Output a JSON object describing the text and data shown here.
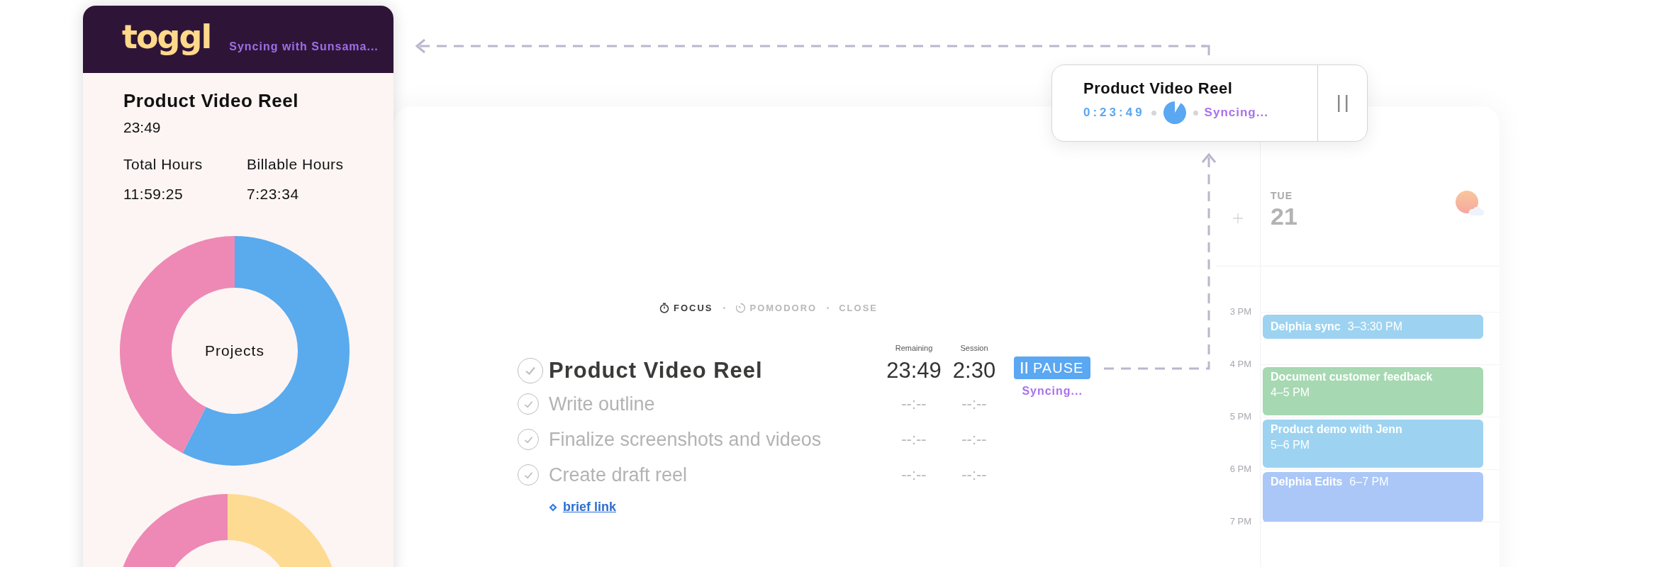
{
  "panel": {
    "logo": "toggl",
    "status": "Syncing with Sunsama...",
    "title": "Product Video Reel",
    "elapsed": "23:49",
    "stats": [
      {
        "label": "Total Hours",
        "value": "11:59:25"
      },
      {
        "label": "Billable Hours",
        "value": "7:23:34"
      }
    ],
    "donut_label": "Projects"
  },
  "mini_timer": {
    "title": "Product Video Reel",
    "elapsed": "0:23:49",
    "status": "Syncing..."
  },
  "focus": {
    "modes": [
      {
        "label": "FOCUS",
        "selected": true,
        "kind": "stopwatch"
      },
      {
        "label": "POMODORO",
        "selected": false,
        "kind": "timer"
      }
    ],
    "close": "CLOSE",
    "columns": [
      "Remaining",
      "Session"
    ],
    "tasks": [
      {
        "title": "Product Video Reel",
        "remaining": "23:49",
        "session": "2:30",
        "kind": "main",
        "checked": false
      },
      {
        "title": "Write outline",
        "remaining": "--:--",
        "session": "--:--",
        "kind": "subtask",
        "checked": false
      },
      {
        "title": "Finalize screenshots and videos",
        "remaining": "--:--",
        "session": "--:--",
        "kind": "subtask",
        "checked": false
      },
      {
        "title": "Create draft reel",
        "remaining": "--:--",
        "session": "--:--",
        "kind": "subtask",
        "checked": false
      }
    ],
    "link": "brief link",
    "pause": "PAUSE",
    "status": "Syncing..."
  },
  "calendar": {
    "weekday": "TUE",
    "day": "21",
    "hours": [
      {
        "label": "3 PM",
        "events": [
          {
            "title": "Delphia sync",
            "time": "3–3:30 PM",
            "kind": "short",
            "color": "#9dd3f0"
          }
        ]
      },
      {
        "label": "4 PM",
        "events": [
          {
            "title": "Document customer feedback",
            "time": "4–5 PM",
            "kind": "stacked",
            "color": "#a6d8b2"
          }
        ]
      },
      {
        "label": "5 PM",
        "events": [
          {
            "title": "Product demo with Jenn",
            "time": "5–6 PM",
            "kind": "stacked",
            "color": "#9dd3f0"
          }
        ]
      },
      {
        "label": "6 PM",
        "events": [
          {
            "title": "Delphia Edits",
            "time": "6–7 PM",
            "kind": "inline",
            "color": "#aac7f7"
          }
        ]
      },
      {
        "label": "7 PM"
      }
    ]
  }
}
